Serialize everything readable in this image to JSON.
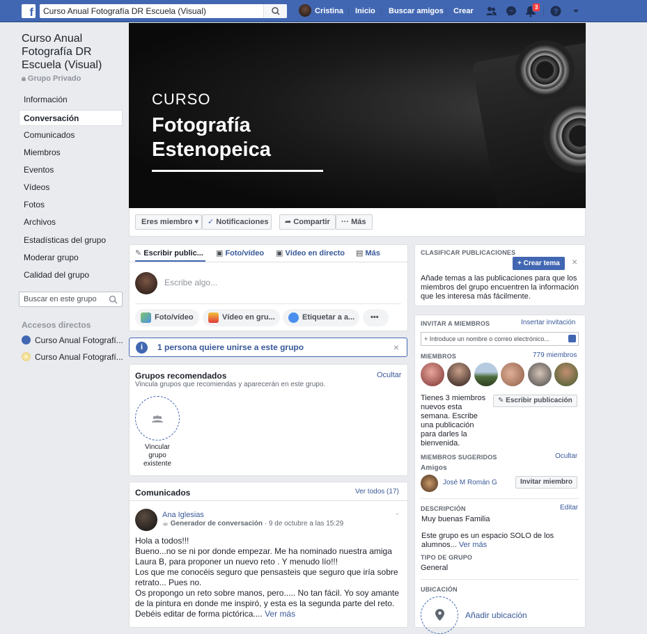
{
  "topbar": {
    "search_value": "Curso Anual Fotografía DR Escuela (Visual)",
    "user_name": "Cristina",
    "nav_home": "Inicio",
    "nav_find_friends": "Buscar amigos",
    "nav_create": "Crear",
    "notification_count": "3"
  },
  "group": {
    "title": "Curso Anual Fotografía DR Escuela (Visual)",
    "privacy": "Grupo Privado"
  },
  "sidebar": {
    "items": [
      {
        "label": "Información"
      },
      {
        "label": "Conversación"
      },
      {
        "label": "Comunicados"
      },
      {
        "label": "Miembros"
      },
      {
        "label": "Eventos"
      },
      {
        "label": "Vídeos"
      },
      {
        "label": "Fotos"
      },
      {
        "label": "Archivos"
      },
      {
        "label": "Estadísticas del grupo"
      },
      {
        "label": "Moderar grupo"
      },
      {
        "label": "Calidad del grupo"
      }
    ],
    "search_placeholder": "Buscar en este grupo",
    "shortcuts_header": "Accesos directos",
    "shortcuts": [
      {
        "label": "Curso Anual Fotografí..."
      },
      {
        "label": "Curso Anual Fotografí..."
      }
    ]
  },
  "cover": {
    "line1": "CURSO",
    "line2": "Fotografía",
    "line3": "Estenopeica"
  },
  "actions": {
    "member": "Eres miembro",
    "notifications": "Notificaciones",
    "share": "Compartir",
    "more": "Más"
  },
  "composer": {
    "tab_write": "Escribir public...",
    "tab_photo": "Foto/vídeo",
    "tab_live": "Vídeo en directo",
    "tab_more": "Más",
    "placeholder": "Escribe algo...",
    "pill_photo": "Foto/vídeo",
    "pill_video": "Vídeo en gru...",
    "pill_tag": "Etiquetar a a..."
  },
  "join_request": {
    "text": "1 persona quiere unirse a este grupo"
  },
  "recommended": {
    "title": "Grupos recomendados",
    "hide": "Ocultar",
    "subtitle": "Vincula grupos que recomiendas y aparecerán en este grupo.",
    "link_label": "Vincular grupo existente"
  },
  "announcements": {
    "title": "Comunicados",
    "see_all": "Ver todos (17)",
    "author": "Ana Iglesias",
    "badge": "Generador de conversación",
    "date": "· 9 de octubre a las 15:29",
    "lines": [
      "Hola a todos!!!",
      "Bueno...no se ni por donde empezar. Me ha nominado nuestra amiga",
      "Laura B, para proponer un nuevo reto . Y menudo lío!!!",
      "Los que me conocéis seguro que pensasteis que seguro que iría sobre",
      "retrato... Pues no.",
      "Os propongo un reto sobre manos, pero..... No tan fácil. Yo soy amante",
      "de la pintura en donde me inspiró, y esta es la segunda parte del reto.",
      "Debéis editar de forma pictórica...."
    ],
    "see_more": "Ver más"
  },
  "classify": {
    "header": "CLASIFICAR PUBLICACIONES",
    "button": "+ Crear tema",
    "text": "Añade temas a las publicaciones para que los miembros del grupo encuentren la información que les interesa más fácilmente."
  },
  "invite": {
    "header": "INVITAR A MIEMBROS",
    "link": "Insertar invitación",
    "placeholder": "+ Introduce un nombre o correo electrónico...",
    "members_header": "MIEMBROS",
    "members_count": "779 miembros",
    "new_members_text": "Tienes 3 miembros nuevos esta semana. Escribe una publicación para darles la bienvenida.",
    "write_post": "Escribir publicación",
    "suggested_header": "MIEMBROS SUGERIDOS",
    "suggested_hide": "Ocultar",
    "friends_label": "Amigos",
    "suggested_name": "José M Román G",
    "invite_button": "Invitar miembro",
    "description_header": "DESCRIPCIÓN",
    "edit": "Editar",
    "description_line1": "Muy buenas Familia",
    "description_line2": "Este grupo es un espacio SOLO de los alumnos...",
    "see_more": "Ver más",
    "type_header": "TIPO DE GRUPO",
    "type_value": "General",
    "location_header": "UBICACIÓN",
    "add_location": "Añadir ubicación"
  }
}
